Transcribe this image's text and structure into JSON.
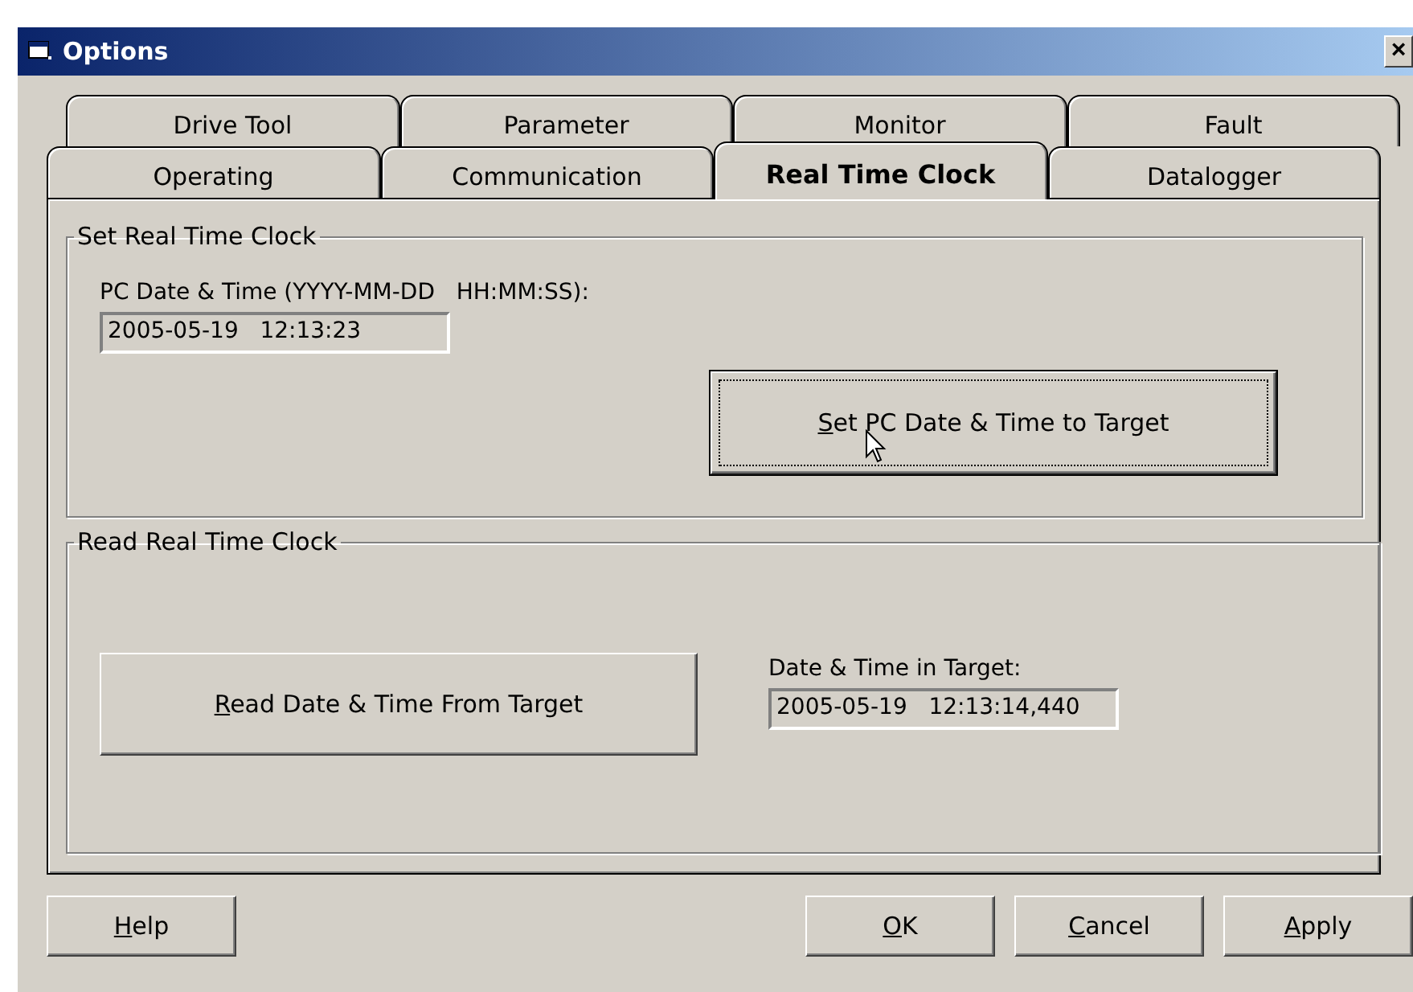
{
  "window": {
    "title": "Options",
    "close_glyph": "×"
  },
  "tab_rows": [
    [
      {
        "label": "Drive Tool",
        "selected": false
      },
      {
        "label": "Parameter",
        "selected": false
      },
      {
        "label": "Monitor",
        "selected": false
      },
      {
        "label": "Fault",
        "selected": false
      }
    ],
    [
      {
        "label": "Operating",
        "selected": false
      },
      {
        "label": "Communication",
        "selected": false
      },
      {
        "label": "Real Time Clock",
        "selected": true
      },
      {
        "label": "Datalogger",
        "selected": false
      }
    ]
  ],
  "set_group": {
    "title": "Set Real Time Clock",
    "field_label": "PC Date & Time (YYYY-MM-DD   HH:MM:SS):",
    "field_value": "2005-05-19   12:13:23",
    "button": {
      "key": "S",
      "after": "et PC Date & Time to Target",
      "focused": true
    }
  },
  "read_group": {
    "title": "Read Real Time Clock",
    "button": {
      "key": "R",
      "after": "ead Date & Time From Target",
      "focused": false
    },
    "field_label": "Date & Time in Target:",
    "field_value": "2005-05-19   12:13:14,440"
  },
  "footer_buttons": [
    {
      "key": "H",
      "after": "elp",
      "focused": false
    },
    {
      "key": "O",
      "after": "K",
      "focused": false
    },
    {
      "key": "C",
      "after": "ancel",
      "focused": false
    },
    {
      "key": "A",
      "after": "pply",
      "focused": false
    }
  ]
}
